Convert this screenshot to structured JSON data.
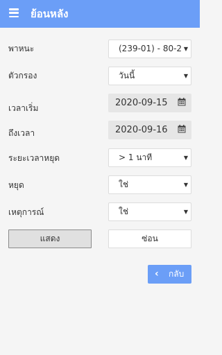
{
  "appbar": {
    "menu_icon": "hamburger-menu-icon",
    "title": "ย้อนหลัง"
  },
  "form": {
    "vehicle_label": "พาหนะ",
    "vehicle_value": "(239-01) - 80-2",
    "filter_label": "ตัวกรอง",
    "filter_value": "วันนี้",
    "start_label": "เวลาเริ่ม",
    "start_value": "2020-09-15",
    "end_label": "ถึงเวลา",
    "end_value": "2020-09-16",
    "stop_duration_label": "ระยะเวลาหยุด",
    "stop_duration_value": "> 1 นาที",
    "stop_label": "หยุด",
    "stop_value": "ใช่",
    "event_label": "เหตุการณ์",
    "event_value": "ใช่",
    "caret_glyph": "▼",
    "calendar_icon": "calendar-icon"
  },
  "actions": {
    "show_label": "แสดง",
    "hide_label": "ซ่อน",
    "back_label": "กลับ",
    "back_icon": "chevron-left-icon"
  },
  "colors": {
    "primary": "#6b9ef7",
    "background": "#f5f5f5"
  }
}
